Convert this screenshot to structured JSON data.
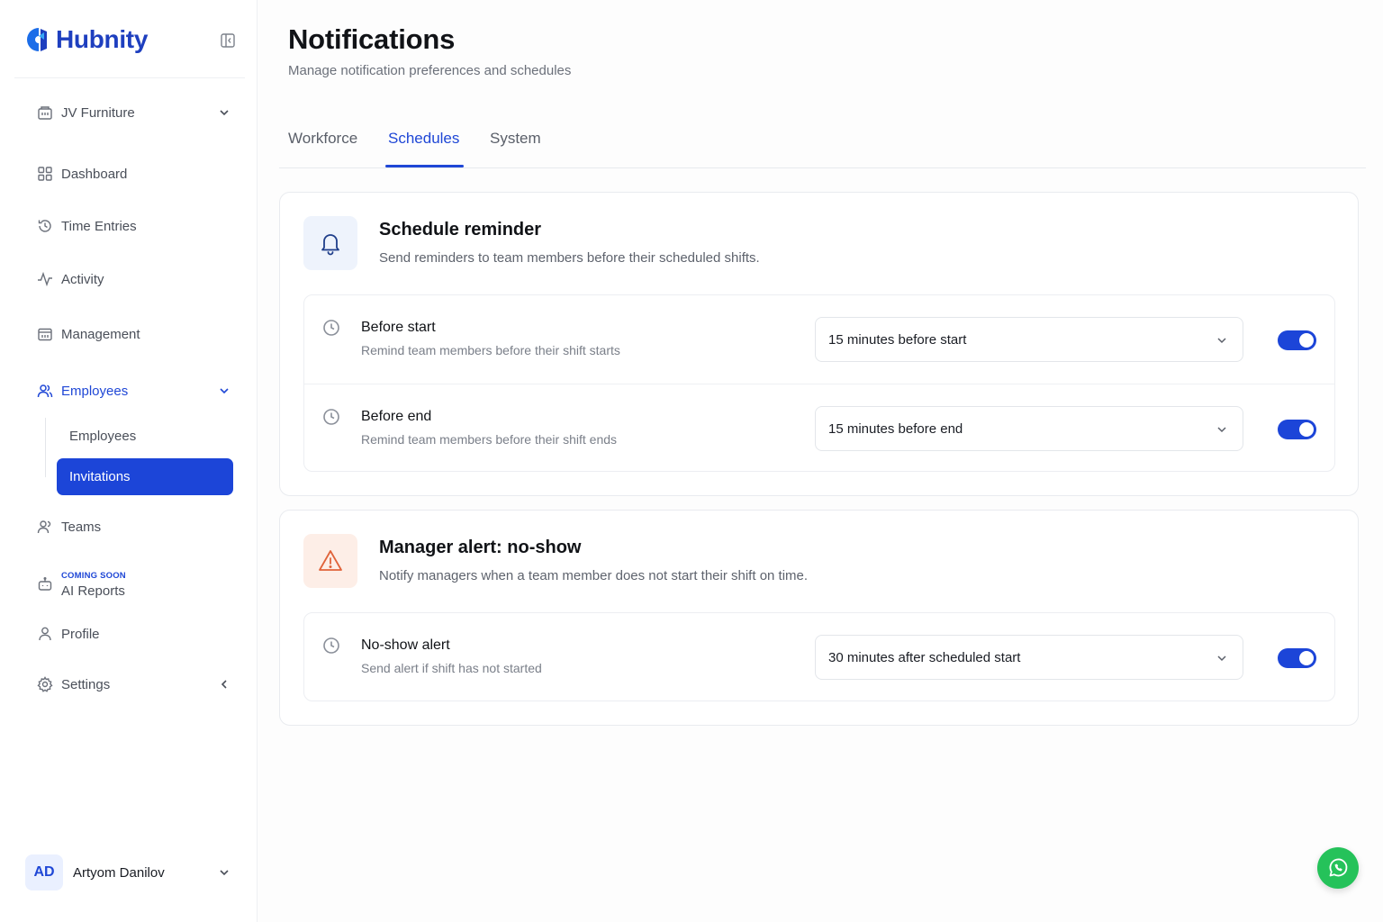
{
  "brand": {
    "name": "Hubnity",
    "color": "#1e3fbf"
  },
  "sidebar": {
    "workspace": {
      "label": "JV Furniture",
      "icon": "building-icon"
    },
    "items": [
      {
        "label": "Dashboard",
        "icon": "grid-icon"
      },
      {
        "label": "Time Entries",
        "icon": "history-icon"
      },
      {
        "label": "Activity",
        "icon": "pulse-icon"
      },
      {
        "label": "Management",
        "icon": "calendar-icon"
      },
      {
        "label": "Employees",
        "icon": "users-icon"
      },
      {
        "label": "Teams",
        "icon": "team-icon"
      },
      {
        "label": "Profile",
        "icon": "user-icon"
      },
      {
        "label": "Settings",
        "icon": "gear-icon"
      }
    ],
    "employees_submenu": [
      {
        "label": "Employees"
      },
      {
        "label": "Invitations"
      }
    ],
    "ai_reports": {
      "badge": "COMING SOON",
      "label": "AI Reports",
      "icon": "bot-icon"
    },
    "user": {
      "initials": "AD",
      "name": "Artyom Danilov"
    }
  },
  "header": {
    "title": "Notifications",
    "subtitle": "Manage notification preferences and schedules"
  },
  "tabs": [
    {
      "label": "Workforce",
      "active": false
    },
    {
      "label": "Schedules",
      "active": true
    },
    {
      "label": "System",
      "active": false
    }
  ],
  "cards": [
    {
      "title": "Schedule reminder",
      "description": "Send reminders to team members before their scheduled shifts.",
      "icon": "bell-icon",
      "rows": [
        {
          "title": "Before start",
          "description": "Remind team members before their shift starts",
          "value": "15 minutes before start",
          "enabled": true
        },
        {
          "title": "Before end",
          "description": "Remind team members before their shift ends",
          "value": "15 minutes before end",
          "enabled": true
        }
      ]
    },
    {
      "title": "Manager alert: no-show",
      "description": "Notify managers when a team member does not start their shift on time.",
      "icon": "warning-icon",
      "rows": [
        {
          "title": "No-show alert",
          "description": "Send alert if shift has not started",
          "value": "30 minutes after scheduled start",
          "enabled": true
        }
      ]
    }
  ],
  "colors": {
    "accent": "#1c45d8",
    "toggle_on": "#1c45d8",
    "whatsapp": "#25c25a",
    "warning": "#e0633a"
  },
  "fab": {
    "icon": "whatsapp-icon"
  }
}
